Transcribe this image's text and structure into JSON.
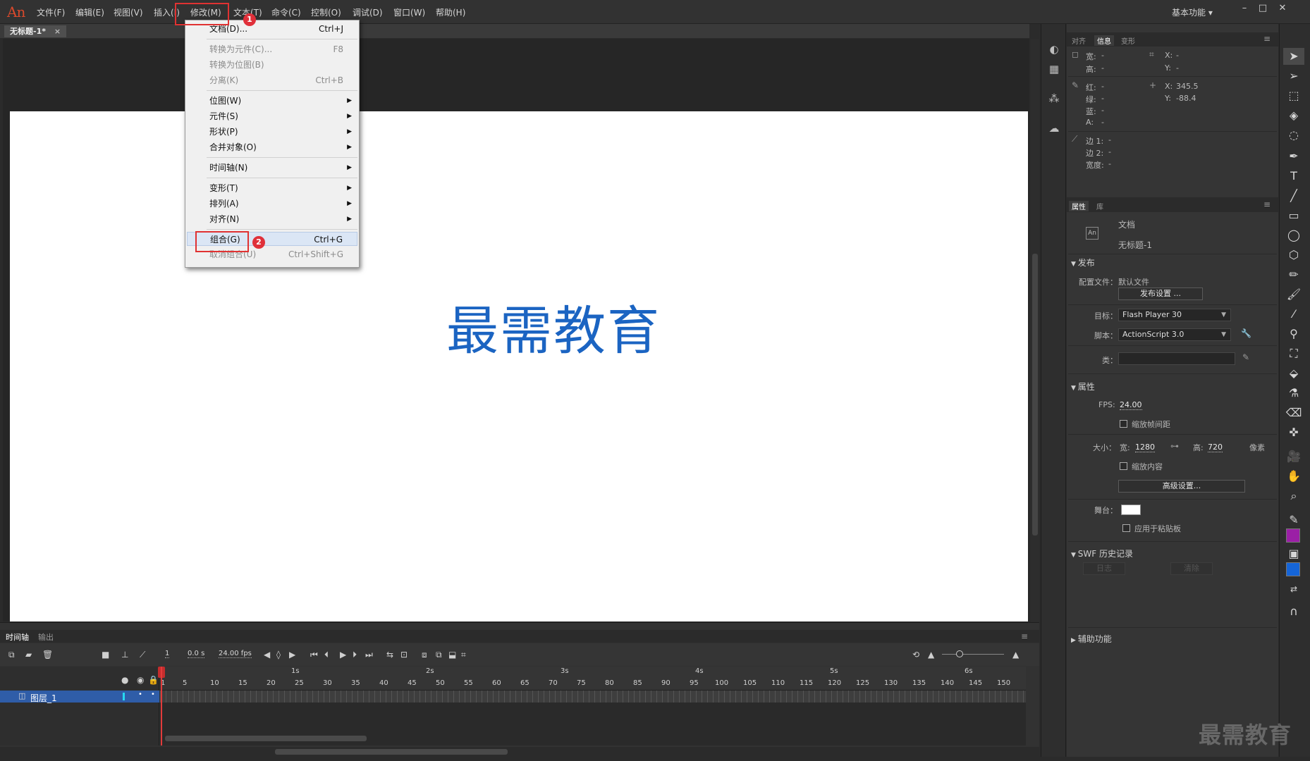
{
  "app": {
    "logo": "An",
    "workspace": "基本功能 ▾",
    "win_min": "–",
    "win_max": "□",
    "win_close": "✕"
  },
  "menu": [
    "文件(F)",
    "编辑(E)",
    "视图(V)",
    "插入(I)",
    "修改(M)",
    "文本(T)",
    "命令(C)",
    "控制(O)",
    "调试(D)",
    "窗口(W)",
    "帮助(H)"
  ],
  "document_tab": {
    "label": "无标题-1*",
    "close": "×"
  },
  "stage_text": "最需教育",
  "dropdown": {
    "items": [
      {
        "label": "文档(D)...",
        "shortcut": "Ctrl+J"
      },
      {
        "label": "转换为元件(C)...",
        "shortcut": "F8"
      },
      {
        "label": "转换为位图(B)",
        "shortcut": ""
      },
      {
        "label": "分离(K)",
        "shortcut": "Ctrl+B"
      },
      {
        "label": "位图(W)",
        "shortcut": ""
      },
      {
        "label": "元件(S)",
        "shortcut": ""
      },
      {
        "label": "形状(P)",
        "shortcut": ""
      },
      {
        "label": "合并对象(O)",
        "shortcut": ""
      },
      {
        "label": "时间轴(N)",
        "shortcut": ""
      },
      {
        "label": "变形(T)",
        "shortcut": ""
      },
      {
        "label": "排列(A)",
        "shortcut": ""
      },
      {
        "label": "对齐(N)",
        "shortcut": ""
      },
      {
        "label": "组合(G)",
        "shortcut": "Ctrl+G"
      },
      {
        "label": "取消组合(U)",
        "shortcut": "Ctrl+Shift+G"
      }
    ],
    "markers": [
      "1",
      "2"
    ]
  },
  "info_panel": {
    "tabs": [
      "对齐",
      "信息",
      "变形"
    ],
    "width_label": "宽:",
    "width_val": "-",
    "height_label": "高:",
    "height_val": "-",
    "x_label": "X:",
    "x_val": "-",
    "y_label": "Y:",
    "y_val": "-",
    "r_label": "红:",
    "r_val": "-",
    "g_label": "绿:",
    "g_val": "-",
    "b_label": "蓝:",
    "b_val": "-",
    "a_label": "A:",
    "a_val": "-",
    "cx_label": "X:",
    "cx_val": "345.5",
    "cy_label": "Y:",
    "cy_val": "-88.4",
    "e1_label": "边 1:",
    "e1_val": "-",
    "e2_label": "边 2:",
    "e2_val": "-",
    "w2_label": "宽度:",
    "w2_val": "-"
  },
  "props_panel": {
    "tabs": [
      "属性",
      "库"
    ],
    "doc_icon": "An",
    "doc_type": "文档",
    "doc_name": "无标题-1",
    "publish": {
      "section": "发布",
      "profile_label": "配置文件：",
      "profile_value": "默认文件",
      "settings_btn": "发布设置 ...",
      "target_label": "目标：",
      "target_value": "Flash Player 30",
      "script_label": "脚本：",
      "script_value": "ActionScript 3.0",
      "class_label": "类："
    },
    "properties": {
      "section": "属性",
      "fps_label": "FPS:",
      "fps_value": "24.00",
      "scale_spans": "缩放帧间距",
      "size_label": "大小：",
      "w_label": "宽:",
      "w_value": "1280",
      "h_label": "高:",
      "h_value": "720",
      "unit": "像素",
      "scale_content": "缩放内容",
      "advanced_btn": "高级设置...",
      "stage_label": "舞台：",
      "stage_color": "#ffffff",
      "apply_paste": "应用于粘贴板"
    },
    "swf": {
      "section": "SWF 历史记录",
      "log_btn": "日志",
      "clear_btn": "清除"
    },
    "accessibility": {
      "section": "辅助功能"
    }
  },
  "timeline": {
    "tabs": [
      "时间轴",
      "输出"
    ],
    "frame": "1",
    "time": "0.0 s",
    "fps": "24.00 fps",
    "layer_name": "图层_1",
    "frame_numbers": [
      "1",
      "5",
      "10",
      "15",
      "20",
      "25",
      "30",
      "35",
      "40",
      "45",
      "50",
      "55",
      "60",
      "65",
      "70",
      "75",
      "80",
      "85",
      "90",
      "95",
      "100",
      "105",
      "110",
      "115",
      "120",
      "125",
      "130",
      "135",
      "140",
      "145",
      "150"
    ],
    "seconds": [
      "1s",
      "2s",
      "3s",
      "4s",
      "5s",
      "6s"
    ]
  },
  "colors": {
    "stroke": "#9b1fa6",
    "fill": "#1565d8",
    "accent_text": "#1b64c2"
  },
  "watermark": "最需教育"
}
